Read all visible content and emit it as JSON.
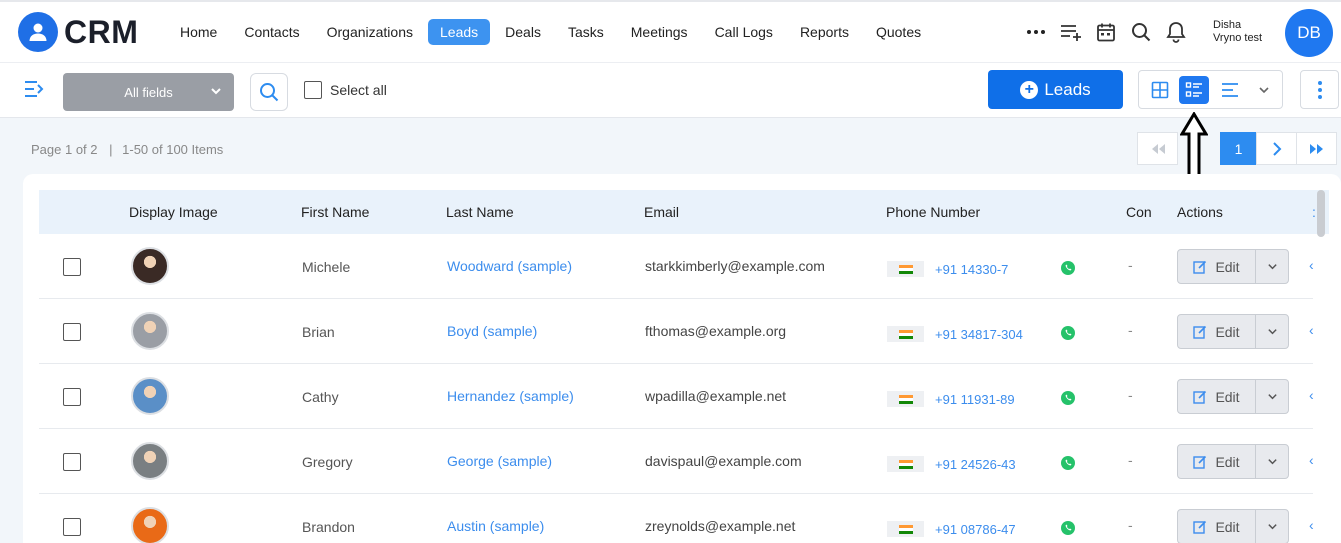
{
  "app": {
    "name": "CRM"
  },
  "nav": {
    "items": [
      {
        "label": "Home",
        "active": false
      },
      {
        "label": "Contacts",
        "active": false
      },
      {
        "label": "Organizations",
        "active": false
      },
      {
        "label": "Leads",
        "active": true
      },
      {
        "label": "Deals",
        "active": false
      },
      {
        "label": "Tasks",
        "active": false
      },
      {
        "label": "Meetings",
        "active": false
      },
      {
        "label": "Call Logs",
        "active": false
      },
      {
        "label": "Reports",
        "active": false
      },
      {
        "label": "Quotes",
        "active": false
      }
    ],
    "icons": [
      "more-icon",
      "add-list-icon",
      "calendar-icon",
      "search-icon",
      "bell-icon"
    ]
  },
  "user": {
    "first": "Disha",
    "second": "Vryno test",
    "initials": "DB"
  },
  "toolbar": {
    "fields_select": "All fields",
    "select_all_label": "Select all",
    "add_button_label": "Leads"
  },
  "pagination": {
    "page_text": "Page 1 of 2",
    "items_text": "1-50 of 100 Items",
    "current_page": "1"
  },
  "table": {
    "headers": {
      "display_image": "Display Image",
      "first_name": "First Name",
      "last_name": "Last Name",
      "email": "Email",
      "phone": "Phone Number",
      "company": "Con",
      "actions": "Actions"
    },
    "rows": [
      {
        "first": "Michele",
        "last": "Woodward (sample)",
        "email": "starkkimberly@example.com",
        "phone": "+91 14330-7",
        "company": "-",
        "edit": "Edit",
        "avatar_color": "#3a2a25"
      },
      {
        "first": "Brian",
        "last": "Boyd (sample)",
        "email": "fthomas@example.org",
        "phone": "+91 34817-304",
        "company": "-",
        "edit": "Edit",
        "avatar_color": "#9a9ea5"
      },
      {
        "first": "Cathy",
        "last": "Hernandez (sample)",
        "email": "wpadilla@example.net",
        "phone": "+91 11931-89",
        "company": "-",
        "edit": "Edit",
        "avatar_color": "#5a8fc7"
      },
      {
        "first": "Gregory",
        "last": "George (sample)",
        "email": "davispaul@example.com",
        "phone": "+91 24526-43",
        "company": "-",
        "edit": "Edit",
        "avatar_color": "#7a7f82"
      },
      {
        "first": "Brandon",
        "last": "Austin (sample)",
        "email": "zreynolds@example.net",
        "phone": "+91 08786-47",
        "company": "-",
        "edit": "Edit",
        "avatar_color": "#e96a17"
      }
    ]
  },
  "colors": {
    "primary": "#0f6fe8",
    "link": "#3c8ded",
    "whatsapp": "#25c26a",
    "header_bg": "#e9f2fb"
  }
}
